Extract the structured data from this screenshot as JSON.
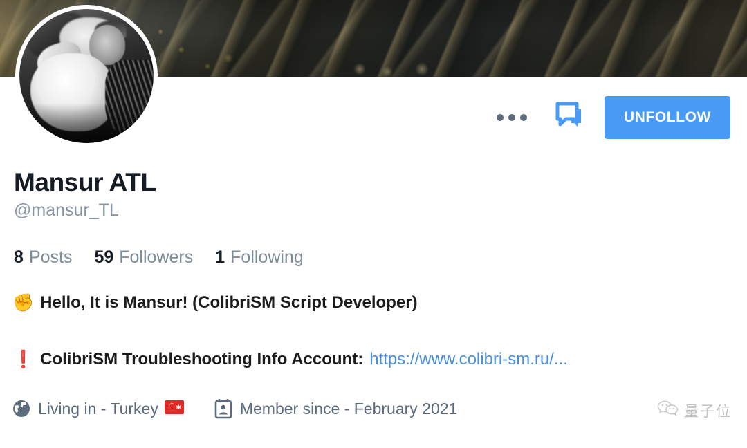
{
  "profile": {
    "display_name": "Mansur ATL",
    "handle": "@mansur_TL",
    "cover_image_alt": "mountain-canyon-landscape",
    "avatar_alt": "black-and-white-portrait-of-man-reclining"
  },
  "actions": {
    "more_label": "more-options",
    "message_label": "message",
    "follow_label": "UNFOLLOW",
    "accent_color": "#4a9bf5"
  },
  "stats": [
    {
      "value": "8",
      "label": "Posts"
    },
    {
      "value": "59",
      "label": "Followers"
    },
    {
      "value": "1",
      "label": "Following"
    }
  ],
  "bio": {
    "line1_emoji": "✊",
    "line1_text": "Hello, It is Mansur! (ColibriSM Script Developer)",
    "line2_emoji": "❗",
    "line2_text": "ColibriSM Troubleshooting Info Account:",
    "line2_link": "https://www.colibri-sm.ru/..."
  },
  "meta": {
    "location_icon": "globe-icon",
    "location_text": "Living in - Turkey",
    "location_flag": "🇹🇷",
    "member_icon": "id-badge-icon",
    "member_text": "Member since - February 2021"
  },
  "watermark": {
    "icon": "wechat-icon",
    "text": "量子位"
  },
  "colors": {
    "text_primary": "#151c24",
    "text_muted": "#7e8c9c",
    "link": "#4a90d9",
    "accent": "#4a9bf5",
    "icon_slate": "#5b6b7c"
  }
}
